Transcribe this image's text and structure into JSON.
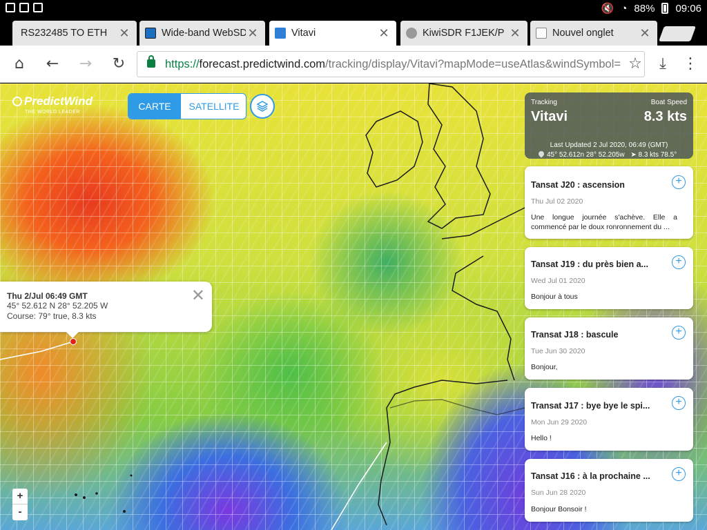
{
  "status": {
    "battery": "88%",
    "time": "09:06"
  },
  "tabs": [
    {
      "title": "RS232485 TO ETH"
    },
    {
      "title": "Wide-band WebSDR"
    },
    {
      "title": "Vitavi"
    },
    {
      "title": "KiwiSDR F1JEK/P"
    },
    {
      "title": "Nouvel onglet"
    }
  ],
  "address": {
    "scheme": "https://",
    "host": "forecast.predictwind.com",
    "path": "/tracking/display/Vitavi?mapMode=useAtlas&windSymbol="
  },
  "map": {
    "logo": "PredictWind",
    "logo_tagline": "THE WORLD LEADER",
    "mode_active": "CARTE",
    "mode_other": "SATELLITE",
    "zoom_in": "+",
    "zoom_out": "-"
  },
  "tracking": {
    "label": "Tracking",
    "boat": "Vitavi",
    "speed_label": "Boat Speed",
    "speed": "8.3 kts",
    "updated": "Last Updated 2 Jul 2020, 06:49 (GMT)",
    "position": "45° 52.612n 28° 52.205w",
    "speed_course": "8.3 kts 78.5°"
  },
  "posts": [
    {
      "title": "Tansat J20 : ascension",
      "date": "Thu Jul 02 2020",
      "excerpt": "Une longue journée s'achève. Elle a commencé par le doux ronronnement du ..."
    },
    {
      "title": "Tansat J19 : du près bien a...",
      "date": "Wed Jul 01 2020",
      "excerpt": "Bonjour à tous"
    },
    {
      "title": "Transat J18 : bascule",
      "date": "Tue Jun 30 2020",
      "excerpt": "Bonjour,"
    },
    {
      "title": "Transat J17 : bye bye le spi...",
      "date": "Mon Jun 29 2020",
      "excerpt": "Hello !"
    },
    {
      "title": "Tansat J16 : à la prochaine ...",
      "date": "Sun Jun 28 2020",
      "excerpt": "Bonjour Bonsoir !"
    }
  ],
  "popup": {
    "time": "Thu 2/Jul 06:49 GMT",
    "coords": "45° 52.612 N  28° 52.205 W",
    "course": "Course:  79° true,  8.3 kts"
  }
}
